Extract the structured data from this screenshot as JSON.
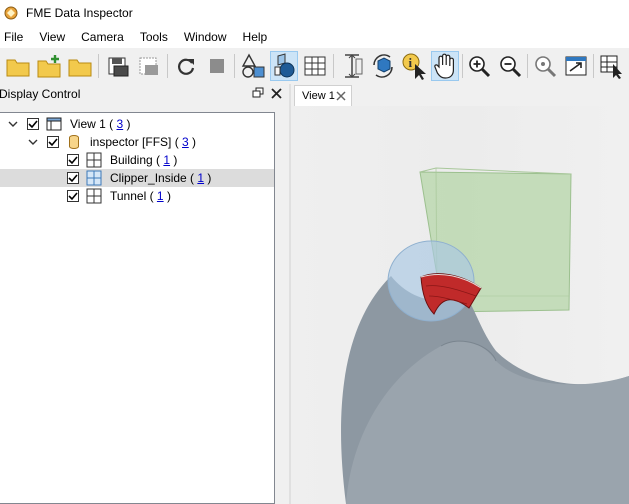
{
  "window": {
    "title": "FME Data Inspector"
  },
  "menu": [
    "File",
    "View",
    "Camera",
    "Tools",
    "Window",
    "Help"
  ],
  "toolbar_icons": [
    "open-folder-icon",
    "add-dataset-icon",
    "open-folder-2-icon",
    "save-dataset-icon",
    "save-disabled-icon",
    "refresh-icon",
    "stop-icon",
    "geometry-shapes-icon",
    "3d-view-icon",
    "table-view-icon",
    "measure-height-icon",
    "orbit-icon",
    "info-select-icon",
    "pan-hand-icon",
    "zoom-in-icon",
    "zoom-out-icon",
    "zoom-extent-icon",
    "zoom-window-icon",
    "select-table-icon"
  ],
  "panel": {
    "title": "Display Control"
  },
  "tree": {
    "view": {
      "label": "View 1",
      "count": "3"
    },
    "dataset": {
      "label": "inspector [FFS]",
      "count": "3"
    },
    "layers": [
      {
        "label": "Building",
        "count": "1",
        "selected": false
      },
      {
        "label": "Clipper_Inside",
        "count": "1",
        "selected": true
      },
      {
        "label": "Tunnel",
        "count": "1",
        "selected": false
      }
    ]
  },
  "tabs": [
    {
      "label": "View 1"
    }
  ],
  "colors": {
    "accent_hover": "#cce4f7",
    "link": "#0000cc",
    "building_fill": "#b6d6a8",
    "tunnel_fill": "#8d98a2",
    "clipper_fill": "#c02a2a"
  }
}
